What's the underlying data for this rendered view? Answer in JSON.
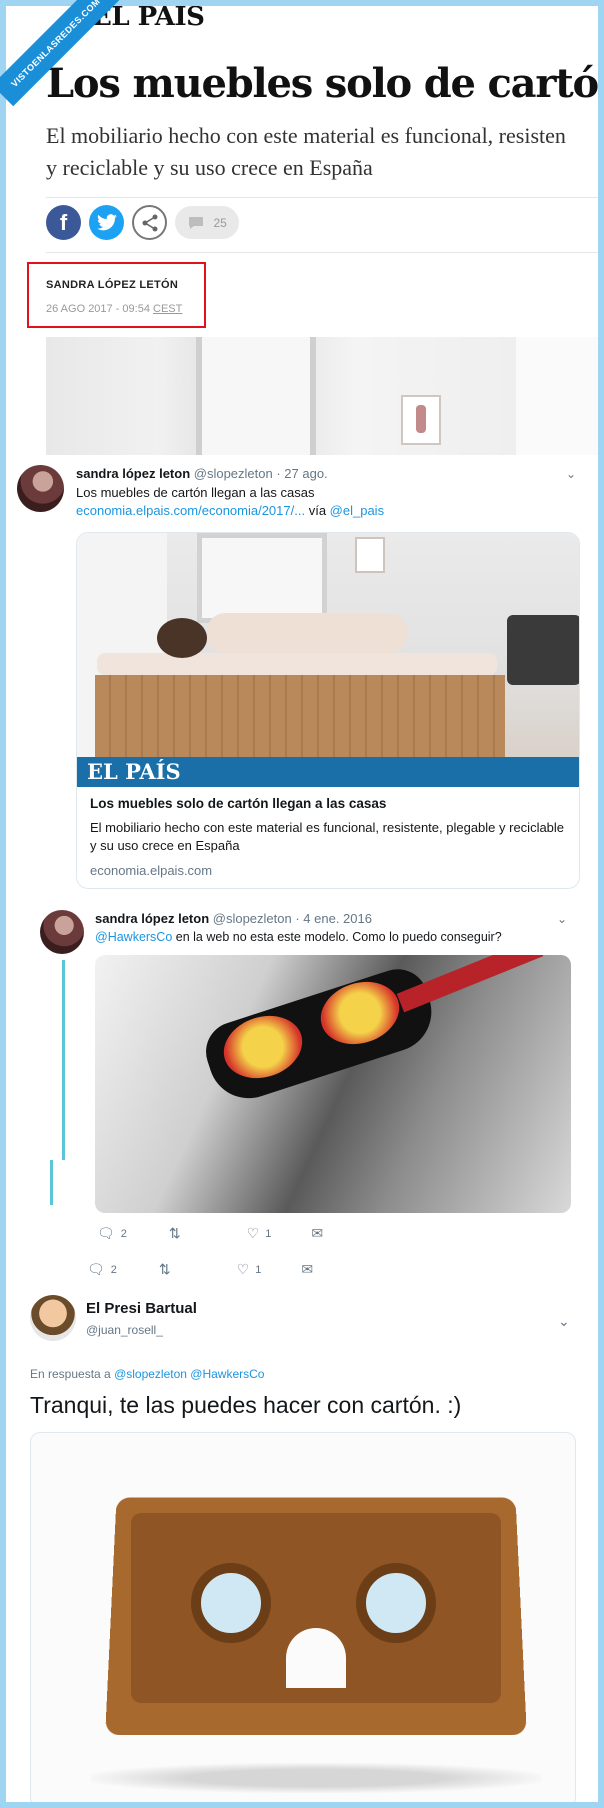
{
  "watermark": {
    "text": "VISTOENLASREDES.COM"
  },
  "article": {
    "logo": "EL PAÍS",
    "headline": "Los muebles solo de cartón llega",
    "subhead_line1": "El mobiliario hecho con este material es funcional, resisten",
    "subhead_line2": "y reciclable y su uso crece en España",
    "comment_count": "25",
    "author": "SANDRA LÓPEZ LETÓN",
    "date": "26 AGO 2017 - 09:54",
    "timezone": "CEST"
  },
  "tweet1": {
    "name": "sandra lópez leton",
    "handle_time": "@slopezleton · 27 ago.",
    "text": "Los muebles de cartón llegan a las casas",
    "link": "economia.elpais.com/economia/2017/...",
    "via": "vía",
    "via_handle": "@el_pais",
    "card": {
      "logo": "EL PAÍS",
      "title": "Los muebles solo de cartón llegan a las casas",
      "description": "El mobiliario hecho con este material es funcional, resistente, plegable y reciclable y su uso crece en España",
      "domain": "economia.elpais.com"
    },
    "replies": "2",
    "likes": "1"
  },
  "tweet2": {
    "name": "sandra lópez leton",
    "handle_time": "@slopezleton · 4 ene. 2016",
    "mention": "@HawkersCo",
    "text": " en la web no esta este modelo. Como lo puedo conseguir?",
    "replies": "2",
    "likes": "1"
  },
  "tweet3": {
    "name": "El Presi Bartual",
    "handle": "@juan_rosell_",
    "reply_prefix": "En respuesta a",
    "reply_to": "@slopezleton @HawkersCo",
    "text": "Tranqui, te las puedes hacer con cartón. :)"
  },
  "colors": {
    "twitter_blue": "#1b95e0",
    "elpais_blue": "#1a6fa8",
    "highlight_red": "#e2121b",
    "thread_line": "#5cc5d6"
  }
}
